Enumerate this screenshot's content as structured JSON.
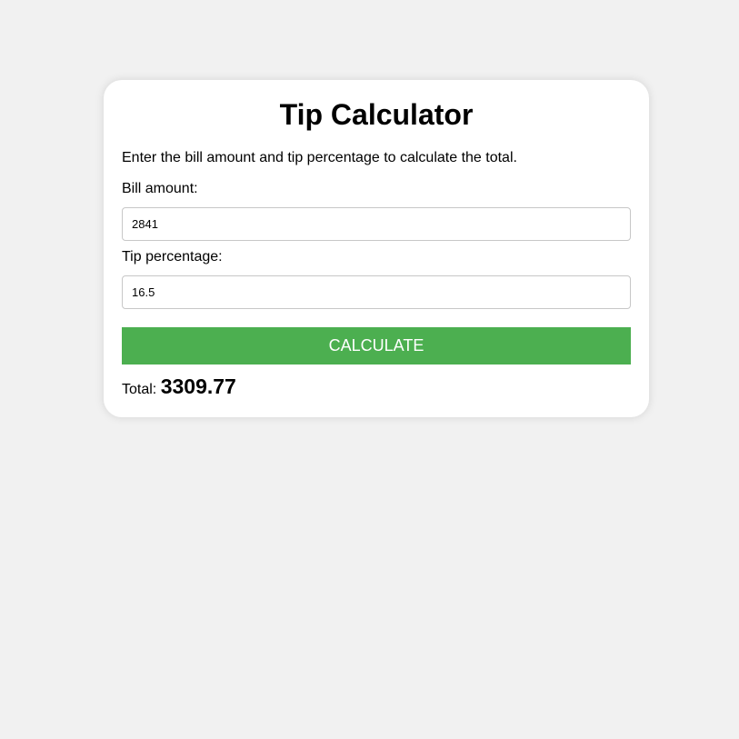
{
  "title": "Tip Calculator",
  "description": "Enter the bill amount and tip percentage to calculate the total.",
  "bill": {
    "label": "Bill amount:",
    "value": "2841"
  },
  "tip": {
    "label": "Tip percentage:",
    "value": "16.5"
  },
  "button": {
    "label": "CALCULATE"
  },
  "result": {
    "label": "Total:",
    "value": "3309.77"
  },
  "colors": {
    "background": "#f1f1f1",
    "card": "#ffffff",
    "button": "#4caf50",
    "button_text": "#ffffff"
  }
}
